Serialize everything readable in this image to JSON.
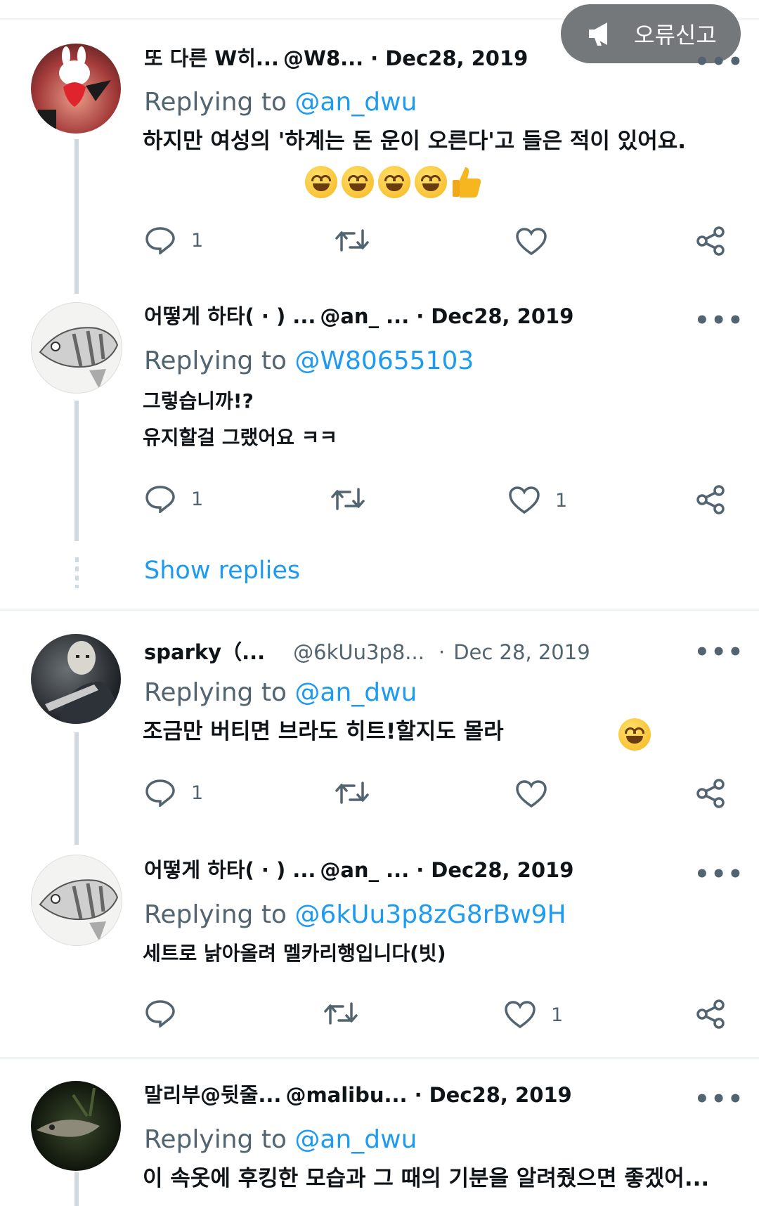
{
  "report_button": {
    "label": "오류신고"
  },
  "show_replies": "Show replies",
  "replying_prefix": "Replying to",
  "tweets": [
    {
      "name": "또 다른 W히...",
      "handle": "@W8...",
      "date": "Dec28, 2019",
      "replying_to": "@an_dwu",
      "text": [
        "하지만 여성의 '하계는 돈 운이 오른다'고 들은 적이 있어요."
      ],
      "emoji": [
        "grinning-squinting-face",
        "grinning-squinting-face",
        "grinning-squinting-face",
        "grinning-squinting-face",
        "thumbs-up"
      ],
      "replies": "1",
      "likes": ""
    },
    {
      "name": "어떻게 하타( · ) ...",
      "handle": "@an_ ...",
      "date": "Dec28, 2019",
      "replying_to": "@W80655103",
      "text": [
        "그렇습니까!?",
        "유지할걸 그랬어요 ㅋㅋ"
      ],
      "replies": "1",
      "likes": "1"
    },
    {
      "name": "sparky（...",
      "handle": "@6kUu3p8...",
      "date": "Dec 28, 2019",
      "replying_to": "@an_dwu",
      "text": [
        "조금만 버티면 브라도 히트!할지도 몰라"
      ],
      "emoji": [
        "grinning-face"
      ],
      "replies": "1",
      "likes": ""
    },
    {
      "name": "어떻게 하타( · ) ...",
      "handle": "@an_ ...",
      "date": "Dec28, 2019",
      "replying_to": "@6kUu3p8zG8rBw9H",
      "text": [
        "세트로 낡아올려 멜카리행입니다(빗)"
      ],
      "replies": "",
      "likes": "1"
    },
    {
      "name": "말리부@뒷줄...",
      "handle": "@malibu...",
      "date": "Dec28, 2019",
      "replying_to": "@an_dwu",
      "text": [
        "이 속옷에 후킹한 모습과 그 때의 기분을 알려줬으면 좋겠어..."
      ]
    }
  ]
}
